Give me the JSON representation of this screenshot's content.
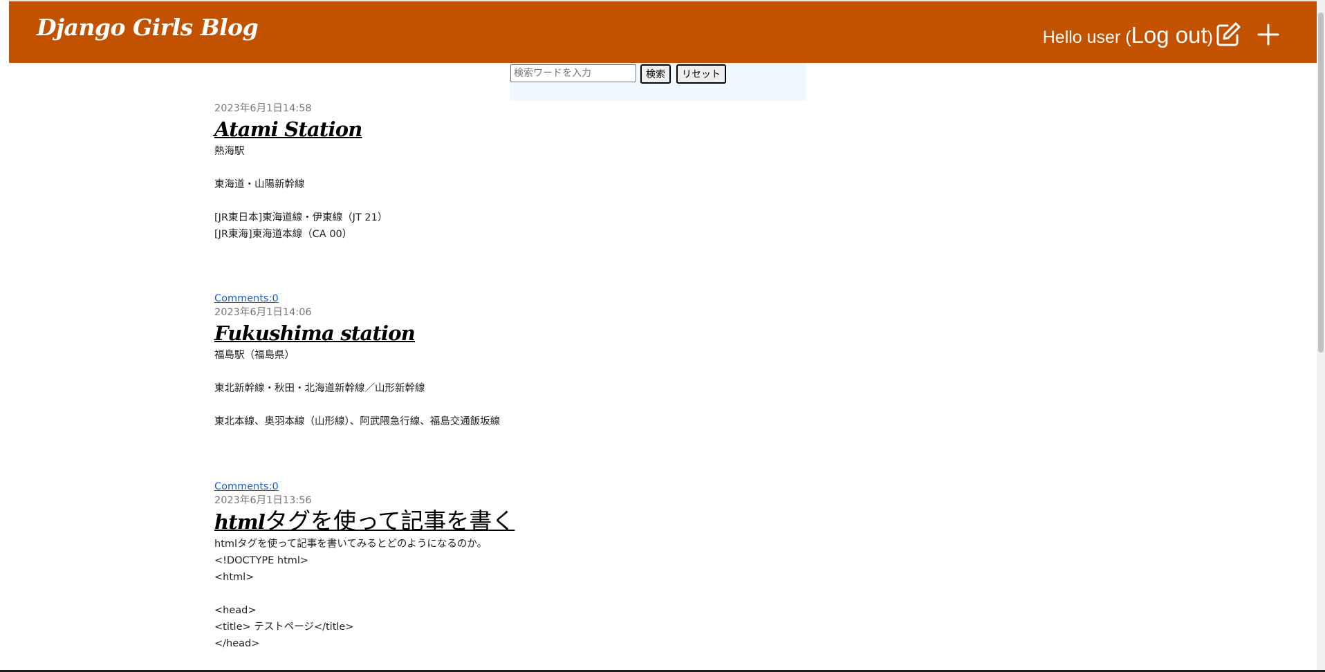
{
  "header": {
    "brand": "Django Girls Blog",
    "greeting": "Hello user (",
    "logout_label": "Log out",
    "greeting_close": ")",
    "edit_icon": "edit-icon",
    "add_icon": "plus-icon",
    "bg_color": "#c25100"
  },
  "search": {
    "placeholder": "検索ワードを入力",
    "value": "",
    "search_label": "検索",
    "reset_label": "リセット"
  },
  "posts": [
    {
      "date": "2023年6月1日14:58",
      "title": "Atami Station",
      "lines": [
        "熱海駅",
        "",
        "東海道・山陽新幹線",
        "",
        "[JR東日本]東海道線・伊東線（JT 21）",
        "[JR東海]東海道本線（CA 00）"
      ],
      "comments": "Comments:0"
    },
    {
      "date": "2023年6月1日14:06",
      "title": "Fukushima station",
      "lines": [
        "福島駅（福島県）",
        "",
        "東北新幹線・秋田・北海道新幹線／山形新幹線",
        "",
        "東北本線、奥羽本線（山形線）、阿武隈急行線、福島交通飯坂線"
      ],
      "comments": "Comments:0"
    },
    {
      "date": "2023年6月1日13:56",
      "title_latin": "html",
      "title_jp": "タグを使って記事を書く",
      "lines": [
        "htmlタグを使って記事を書いてみるとどのようになるのか。",
        "<!DOCTYPE html>",
        "<html>",
        "",
        "<head>",
        "<title> テストページ</title>",
        "</head>"
      ]
    }
  ]
}
